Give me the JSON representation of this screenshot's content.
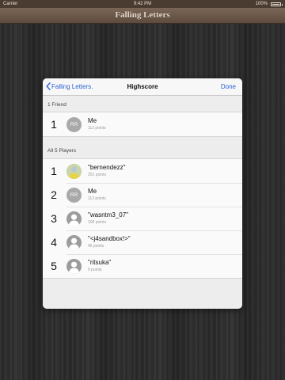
{
  "status_bar": {
    "carrier": "Carrier",
    "time": "9:42 PM",
    "battery": "100%"
  },
  "app": {
    "title": "Falling Letters"
  },
  "popup": {
    "back_label": "Falling Letters.",
    "title": "Highscore",
    "done_label": "Done",
    "friends_section": {
      "header": "1 Friend",
      "rows": [
        {
          "rank": "1",
          "avatar": "RR",
          "avatar_kind": "initials",
          "name": "Me",
          "points": "112 points"
        }
      ]
    },
    "players_section": {
      "header": "All 5 Players",
      "rows": [
        {
          "rank": "1",
          "avatar": "",
          "avatar_kind": "photo",
          "name": "\"bernendezz\"",
          "points": "251 points"
        },
        {
          "rank": "2",
          "avatar": "RR",
          "avatar_kind": "initials",
          "name": "Me",
          "points": "112 points"
        },
        {
          "rank": "3",
          "avatar": "",
          "avatar_kind": "silhouette",
          "name": "\"wasntm3_07\"",
          "points": "100 points"
        },
        {
          "rank": "4",
          "avatar": "",
          "avatar_kind": "silhouette",
          "name": "\"<j4sandbox!>\"",
          "points": "45 points"
        },
        {
          "rank": "5",
          "avatar": "",
          "avatar_kind": "silhouette",
          "name": "\"ritsuka\"",
          "points": "9 points"
        }
      ]
    }
  },
  "colors": {
    "accent": "#2a63d6",
    "header_bg": "#6b5747",
    "title_text": "#e2d7c9"
  }
}
